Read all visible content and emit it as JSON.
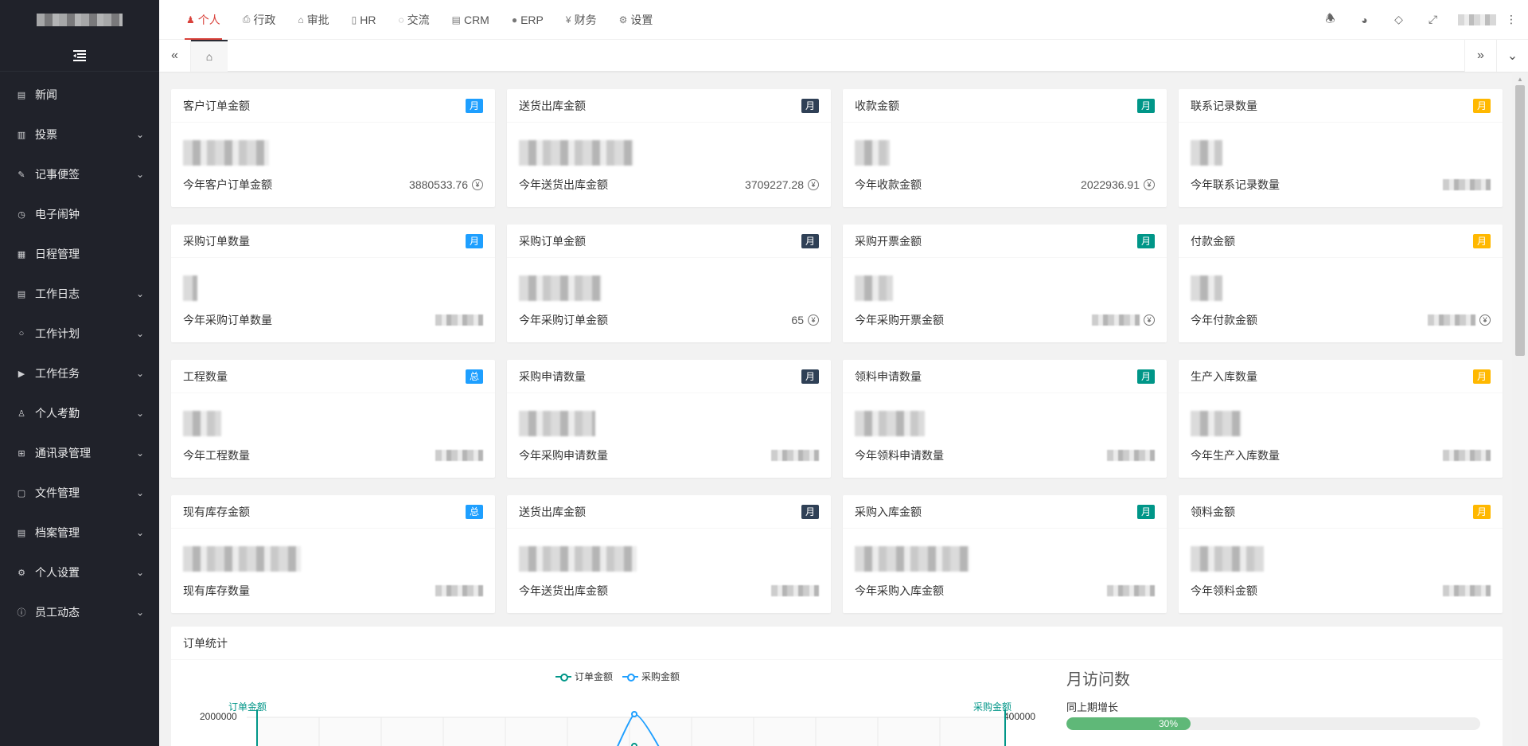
{
  "sidebar": {
    "items": [
      {
        "label": "新闻",
        "icon": "newspaper-icon",
        "glyph": "▤",
        "arrow": ""
      },
      {
        "label": "投票",
        "icon": "vote-icon",
        "glyph": "▥",
        "arrow": "⌄"
      },
      {
        "label": "记事便签",
        "icon": "note-icon",
        "glyph": "✎",
        "arrow": "⌄"
      },
      {
        "label": "电子闹钟",
        "icon": "clock-icon",
        "glyph": "◷",
        "arrow": ""
      },
      {
        "label": "日程管理",
        "icon": "calendar-icon",
        "glyph": "▦",
        "arrow": ""
      },
      {
        "label": "工作日志",
        "icon": "log-icon",
        "glyph": "▤",
        "arrow": "⌄"
      },
      {
        "label": "工作计划",
        "icon": "plan-icon",
        "glyph": "○",
        "arrow": "⌄"
      },
      {
        "label": "工作任务",
        "icon": "task-icon",
        "glyph": "▶",
        "arrow": "⌄"
      },
      {
        "label": "个人考勤",
        "icon": "user-icon",
        "glyph": "♙",
        "arrow": "⌄"
      },
      {
        "label": "通讯录管理",
        "icon": "contacts-icon",
        "glyph": "⊞",
        "arrow": "⌄"
      },
      {
        "label": "文件管理",
        "icon": "file-icon",
        "glyph": "▢",
        "arrow": "⌄"
      },
      {
        "label": "档案管理",
        "icon": "archive-icon",
        "glyph": "▤",
        "arrow": "⌄"
      },
      {
        "label": "个人设置",
        "icon": "gear-icon",
        "glyph": "⚙",
        "arrow": "⌄"
      },
      {
        "label": "员工动态",
        "icon": "info-icon",
        "glyph": "ⓘ",
        "arrow": "⌄"
      }
    ]
  },
  "topnav": {
    "items": [
      {
        "label": "个人",
        "icon": "person-icon",
        "glyph": "♟",
        "active": true
      },
      {
        "label": "行政",
        "icon": "printer-icon",
        "glyph": "⎙",
        "active": false
      },
      {
        "label": "审批",
        "icon": "approval-icon",
        "glyph": "⌂",
        "active": false
      },
      {
        "label": "HR",
        "icon": "hr-icon",
        "glyph": "▯",
        "active": false
      },
      {
        "label": "交流",
        "icon": "chat-icon",
        "glyph": "◌",
        "active": false
      },
      {
        "label": "CRM",
        "icon": "crm-icon",
        "glyph": "▤",
        "active": false
      },
      {
        "label": "ERP",
        "icon": "erp-icon",
        "glyph": "●",
        "active": false
      },
      {
        "label": "财务",
        "icon": "yen-icon",
        "glyph": "¥",
        "active": false
      },
      {
        "label": "设置",
        "icon": "gear-icon",
        "glyph": "⚙",
        "active": false
      }
    ]
  },
  "header_icons": [
    "bell-icon",
    "theme-icon",
    "tag-icon",
    "fullscreen-icon"
  ],
  "tabbar": {
    "home_glyph": "⌂"
  },
  "cards": [
    {
      "title": "客户订单金额",
      "badge": "月",
      "badge_color": "blue",
      "footer": "今年客户订单金额",
      "value": "3880533.76",
      "currency": true
    },
    {
      "title": "送货出库金额",
      "badge": "月",
      "badge_color": "dark",
      "footer": "今年送货出库金额",
      "value": "3709227.28",
      "currency": true
    },
    {
      "title": "收款金额",
      "badge": "月",
      "badge_color": "green",
      "footer": "今年收款金额",
      "value": "2022936.91",
      "currency": true
    },
    {
      "title": "联系记录数量",
      "badge": "月",
      "badge_color": "orange",
      "footer": "今年联系记录数量",
      "value": "",
      "currency": false
    },
    {
      "title": "采购订单数量",
      "badge": "月",
      "badge_color": "blue",
      "footer": "今年采购订单数量",
      "value": "",
      "currency": false
    },
    {
      "title": "采购订单金额",
      "badge": "月",
      "badge_color": "dark",
      "footer": "今年采购订单金额",
      "value": "65",
      "currency": true
    },
    {
      "title": "采购开票金额",
      "badge": "月",
      "badge_color": "green",
      "footer": "今年采购开票金额",
      "value": "",
      "currency": true
    },
    {
      "title": "付款金额",
      "badge": "月",
      "badge_color": "orange",
      "footer": "今年付款金额",
      "value": "",
      "currency": true
    },
    {
      "title": "工程数量",
      "badge": "总",
      "badge_color": "blue",
      "footer": "今年工程数量",
      "value": "",
      "currency": false
    },
    {
      "title": "采购申请数量",
      "badge": "月",
      "badge_color": "dark",
      "footer": "今年采购申请数量",
      "value": "",
      "currency": false
    },
    {
      "title": "领料申请数量",
      "badge": "月",
      "badge_color": "green",
      "footer": "今年领料申请数量",
      "value": "",
      "currency": false
    },
    {
      "title": "生产入库数量",
      "badge": "月",
      "badge_color": "orange",
      "footer": "今年生产入库数量",
      "value": "",
      "currency": false
    },
    {
      "title": "现有库存金额",
      "badge": "总",
      "badge_color": "blue",
      "footer": "现有库存数量",
      "value": "",
      "currency": false
    },
    {
      "title": "送货出库金额",
      "badge": "月",
      "badge_color": "dark",
      "footer": "今年送货出库金额",
      "value": "",
      "currency": false
    },
    {
      "title": "采购入库金额",
      "badge": "月",
      "badge_color": "green",
      "footer": "今年采购入库金额",
      "value": "",
      "currency": false
    },
    {
      "title": "领料金额",
      "badge": "月",
      "badge_color": "orange",
      "footer": "今年领料金额",
      "value": "",
      "currency": false
    }
  ],
  "order_stats": {
    "title": "订单统计",
    "legend": [
      "订单金额",
      "采购金额"
    ],
    "y_left_name": "订单金额",
    "y_right_name": "采购金额",
    "y_left_top": "2000000",
    "y_right_top": "400000"
  },
  "visits": {
    "title": "月访问数",
    "subtitle": "同上期增长",
    "progress_percent": 30,
    "progress_label": "30%"
  },
  "colors": {
    "sidebar_bg": "#20222a",
    "active": "#d9413a",
    "badge_blue": "#1e9fff",
    "badge_dark": "#2f4056",
    "badge_green": "#009688",
    "badge_orange": "#ffb800",
    "progress": "#5fb878"
  }
}
